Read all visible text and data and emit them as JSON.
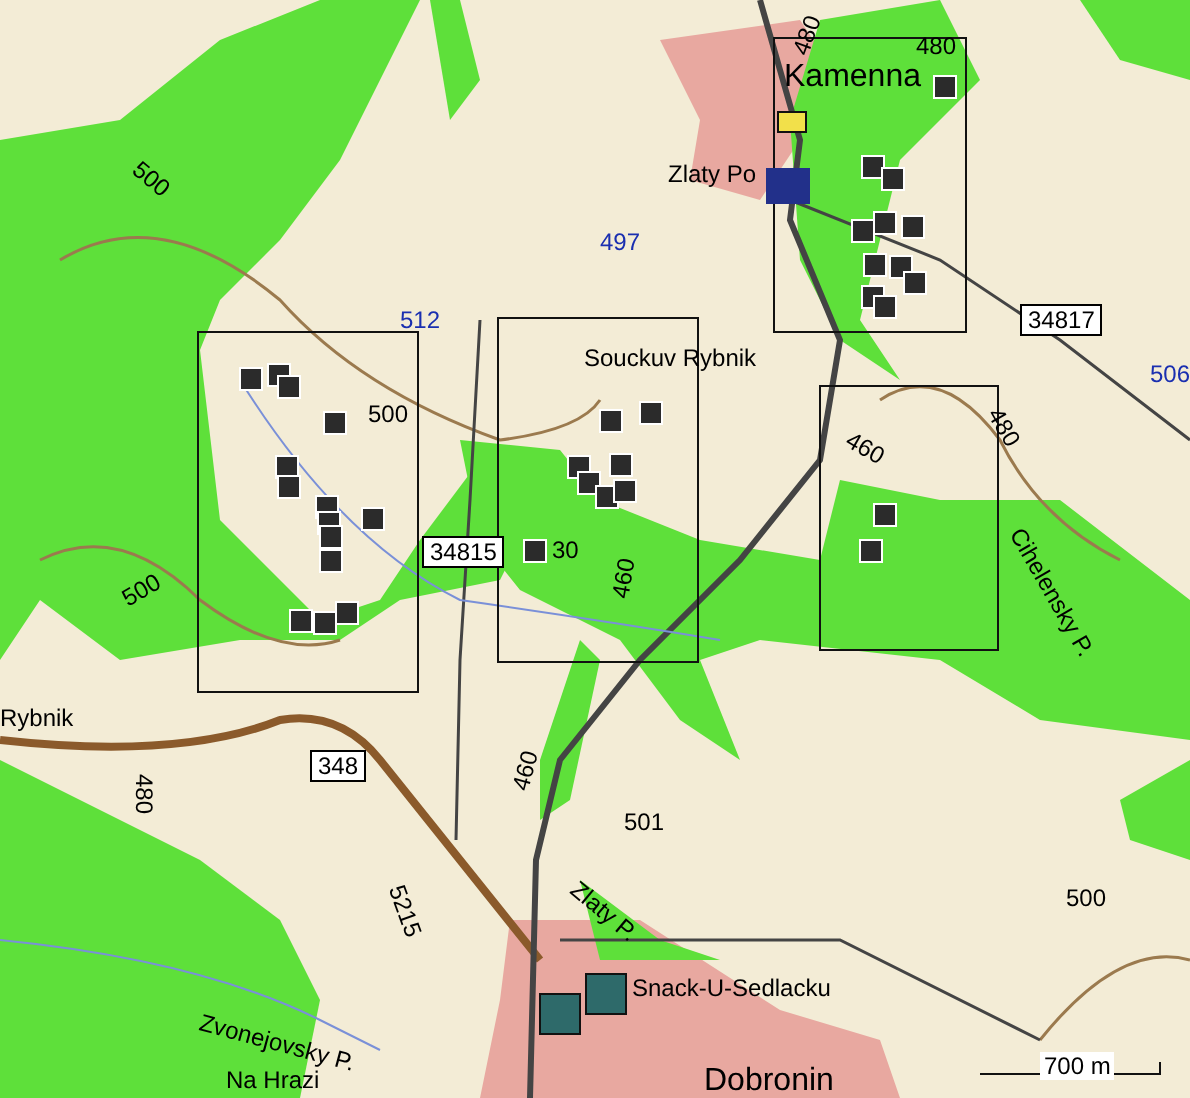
{
  "map": {
    "labels": [
      {
        "kind": "contour",
        "text": "480"
      },
      {
        "kind": "town",
        "text": "Kamenna"
      },
      {
        "kind": "contour",
        "text": "480"
      },
      {
        "kind": "place",
        "text": "Zlaty Po"
      },
      {
        "kind": "route",
        "text": "497"
      },
      {
        "kind": "route",
        "text": "512"
      },
      {
        "kind": "place",
        "text": "Souckuv Rybnik"
      },
      {
        "kind": "road",
        "text": "34817"
      },
      {
        "kind": "route",
        "text": "506"
      },
      {
        "kind": "contour",
        "text": "500"
      },
      {
        "kind": "contour",
        "text": "500"
      },
      {
        "kind": "contour",
        "text": "460"
      },
      {
        "kind": "contour",
        "text": "480"
      },
      {
        "kind": "water",
        "text": "Cihelensky P."
      },
      {
        "kind": "road",
        "text": "34815"
      },
      {
        "kind": "contour",
        "text": "30"
      },
      {
        "kind": "contour",
        "text": "460"
      },
      {
        "kind": "contour",
        "text": "500"
      },
      {
        "kind": "place",
        "text": "Rybnik"
      },
      {
        "kind": "contour",
        "text": "480"
      },
      {
        "kind": "road",
        "text": "348"
      },
      {
        "kind": "contour",
        "text": "460"
      },
      {
        "kind": "contour",
        "text": "501"
      },
      {
        "kind": "contour",
        "text": "5215"
      },
      {
        "kind": "water",
        "text": "Zlaty P."
      },
      {
        "kind": "contour",
        "text": "500"
      },
      {
        "kind": "place",
        "text": "Snack-U-Sedlacku"
      },
      {
        "kind": "water",
        "text": "Zvonejovsky P."
      },
      {
        "kind": "place",
        "text": "Na Hrazi"
      },
      {
        "kind": "town",
        "text": "Dobronin"
      }
    ]
  },
  "scale_bar": {
    "text": "700 m"
  }
}
